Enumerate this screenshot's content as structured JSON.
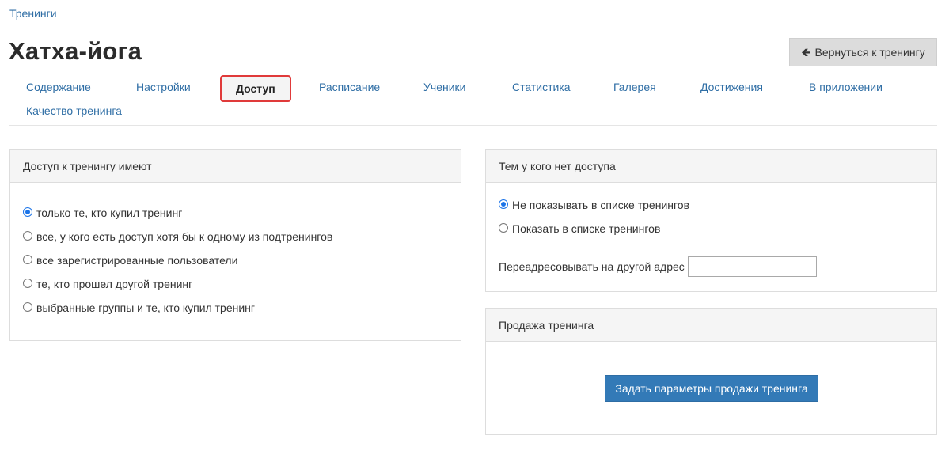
{
  "breadcrumb": {
    "label": "Тренинги"
  },
  "page": {
    "title": "Хатха-йога"
  },
  "header": {
    "back_label": "Вернуться к тренингу"
  },
  "tabs": [
    {
      "label": "Содержание"
    },
    {
      "label": "Настройки"
    },
    {
      "label": "Доступ",
      "active": true
    },
    {
      "label": "Расписание"
    },
    {
      "label": "Ученики"
    },
    {
      "label": "Статистика"
    },
    {
      "label": "Галерея"
    },
    {
      "label": "Достижения"
    },
    {
      "label": "В приложении"
    },
    {
      "label": "Качество тренинга"
    }
  ],
  "access_panel": {
    "title": "Доступ к тренингу имеют",
    "options": [
      {
        "label": "только те, кто купил тренинг",
        "checked": true
      },
      {
        "label": "все, у кого есть доступ хотя бы к одному из подтренингов",
        "checked": false
      },
      {
        "label": "все зарегистрированные пользователи",
        "checked": false
      },
      {
        "label": "те, кто прошел другой тренинг",
        "checked": false
      },
      {
        "label": "выбранные группы и те, кто купил тренинг",
        "checked": false
      }
    ]
  },
  "no_access_panel": {
    "title": "Тем у кого нет доступа",
    "options": [
      {
        "label": "Не показывать в списке тренингов",
        "checked": true
      },
      {
        "label": "Показать в списке тренингов",
        "checked": false
      }
    ],
    "redirect_label": "Переадресовывать на другой адрес",
    "redirect_value": ""
  },
  "sale_panel": {
    "title": "Продажа тренинга",
    "button_label": "Задать параметры продажи тренинга"
  },
  "colors": {
    "link": "#2f6ea5",
    "active_tab_border": "#e03a3a",
    "primary_button": "#337ab7",
    "radio_checked": "#1a73e8"
  }
}
